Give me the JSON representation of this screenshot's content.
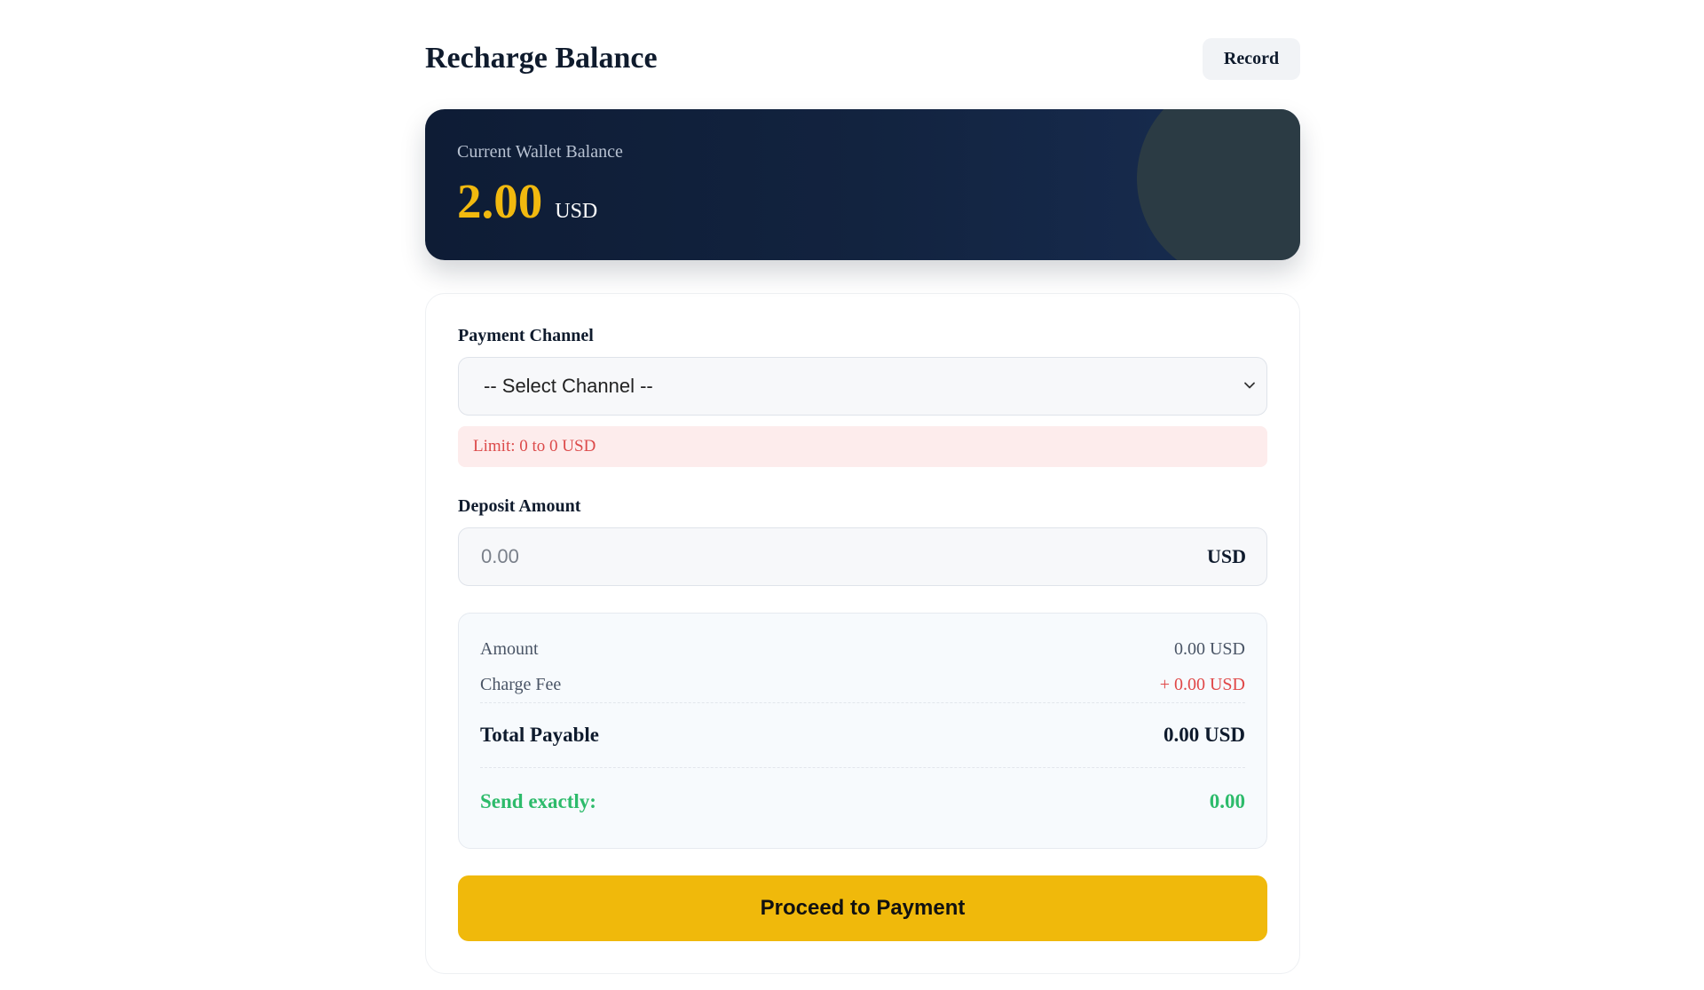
{
  "header": {
    "title": "Recharge Balance",
    "record_label": "Record"
  },
  "balance": {
    "label": "Current Wallet Balance",
    "value": "2.00",
    "currency": "USD",
    "accent_color": "#f1b90f"
  },
  "form": {
    "channel_label": "Payment Channel",
    "channel_selected": "-- Select Channel --",
    "limit_text": "Limit: 0 to 0 USD",
    "deposit_label": "Deposit Amount",
    "amount_placeholder": "0.00",
    "amount_currency": "USD"
  },
  "summary": {
    "amount_label": "Amount",
    "amount_value": "0.00 USD",
    "fee_label": "Charge Fee",
    "fee_value": "+ 0.00 USD",
    "total_label": "Total Payable",
    "total_value": "0.00 USD",
    "send_label": "Send exactly:",
    "send_value": "0.00"
  },
  "actions": {
    "proceed_label": "Proceed to Payment",
    "button_color": "#f0b90b"
  },
  "icons": {
    "select_chevron": "chevron-down-icon"
  }
}
